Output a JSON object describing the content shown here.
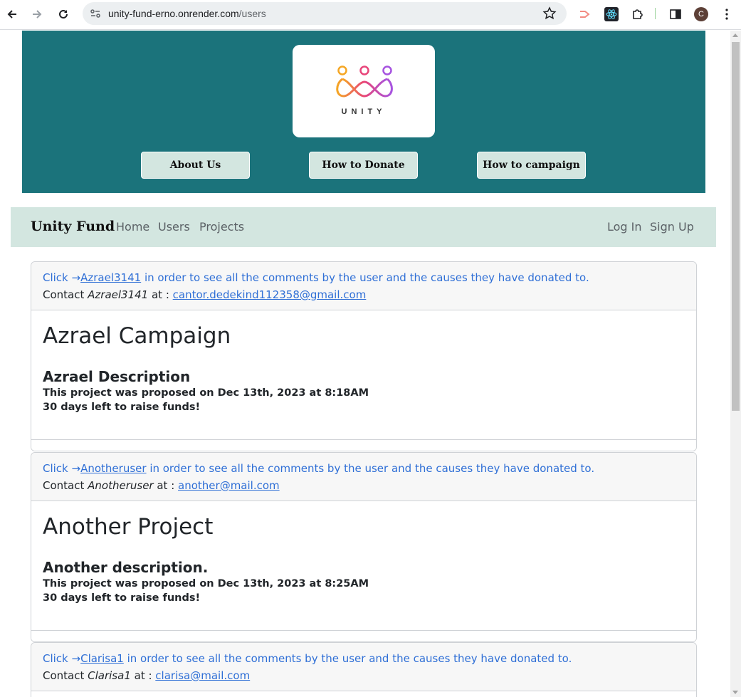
{
  "browser": {
    "url_host": "unity-fund-erno.onrender.com",
    "url_path": "/users",
    "profile_initial": "C"
  },
  "hero": {
    "logo_text": "UNITY",
    "buttons": [
      "About Us",
      "How to Donate",
      "How to campaign"
    ]
  },
  "navbar": {
    "brand": "Unity Fund",
    "links": [
      "Home",
      "Users",
      "Projects"
    ],
    "auth": [
      "Log In",
      "Sign Up"
    ]
  },
  "cards": [
    {
      "click_prefix": "Click →",
      "username": "Azrael3141",
      "click_suffix": " in order to see all the comments by the user and the causes they have donated to.",
      "contact_prefix": "Contact ",
      "contact_name": "Azrael3141",
      "contact_mid": " at : ",
      "email": "cantor.dedekind112358@gmail.com",
      "title": "Azrael Campaign",
      "description": "Azrael Description",
      "proposed": "This project was proposed on Dec 13th, 2023 at 8:18AM",
      "days_left": "30 days left to raise funds!"
    },
    {
      "click_prefix": "Click →",
      "username": "Anotheruser",
      "click_suffix": " in order to see all the comments by the user and the causes they have donated to.",
      "contact_prefix": "Contact ",
      "contact_name": "Anotheruser",
      "contact_mid": " at : ",
      "email": "another@mail.com",
      "title": "Another Project",
      "description": "Another description.",
      "proposed": "This project was proposed on Dec 13th, 2023 at 8:25AM",
      "days_left": "30 days left to raise funds!"
    },
    {
      "click_prefix": "Click →",
      "username": "Clarisa1",
      "click_suffix": " in order to see all the comments by the user and the causes they have donated to.",
      "contact_prefix": "Contact ",
      "contact_name": "Clarisa1",
      "contact_mid": " at : ",
      "email": "clarisa@mail.com"
    }
  ],
  "colors": {
    "hero_bg": "#1b737b",
    "nav_bg": "#d3e6e0",
    "link": "#2f6fd6"
  }
}
